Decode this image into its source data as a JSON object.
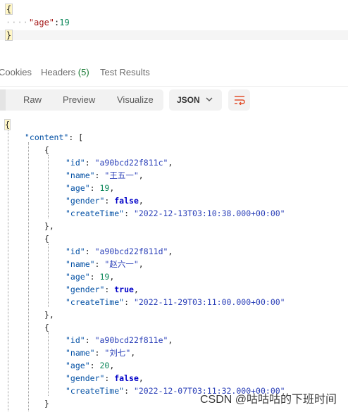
{
  "request_body": {
    "open_brace": "{",
    "indent": "····",
    "key": "\"age\"",
    "colon": ":",
    "value": "19",
    "close_brace": "}"
  },
  "response_tabs": [
    {
      "label": "Cookies"
    },
    {
      "label": "Headers",
      "count": "(5)"
    },
    {
      "label": "Test Results"
    }
  ],
  "format_toolbar": {
    "modes": [
      "Raw",
      "Preview",
      "Visualize"
    ],
    "format_select": "JSON",
    "wrap_icon": "wrap-lines-icon"
  },
  "response_json": {
    "open_brace": "{",
    "content_key": "\"content\"",
    "content_open": "[",
    "records": [
      {
        "id": "\"a90bcd22f811c\"",
        "name": "\"王五一\"",
        "age": "19",
        "gender": "false",
        "createTime": "\"2022-12-13T03:10:38.000+00:00\"",
        "close": "},"
      },
      {
        "id": "\"a90bcd22f811d\"",
        "name": "\"赵六一\"",
        "age": "19",
        "gender": "true",
        "createTime": "\"2022-11-29T03:11:00.000+00:00\"",
        "close": "},"
      },
      {
        "id": "\"a90bcd22f811e\"",
        "name": "\"刘七\"",
        "age": "20",
        "gender": "false",
        "createTime": "\"2022-12-07T03:11:32.000+00:00\"",
        "close": "}"
      }
    ],
    "labels": {
      "id": "\"id\"",
      "name": "\"name\"",
      "age": "\"age\"",
      "gender": "\"gender\"",
      "createTime": "\"createTime\""
    }
  },
  "watermark": "CSDN @咕咕咕的下班时间"
}
